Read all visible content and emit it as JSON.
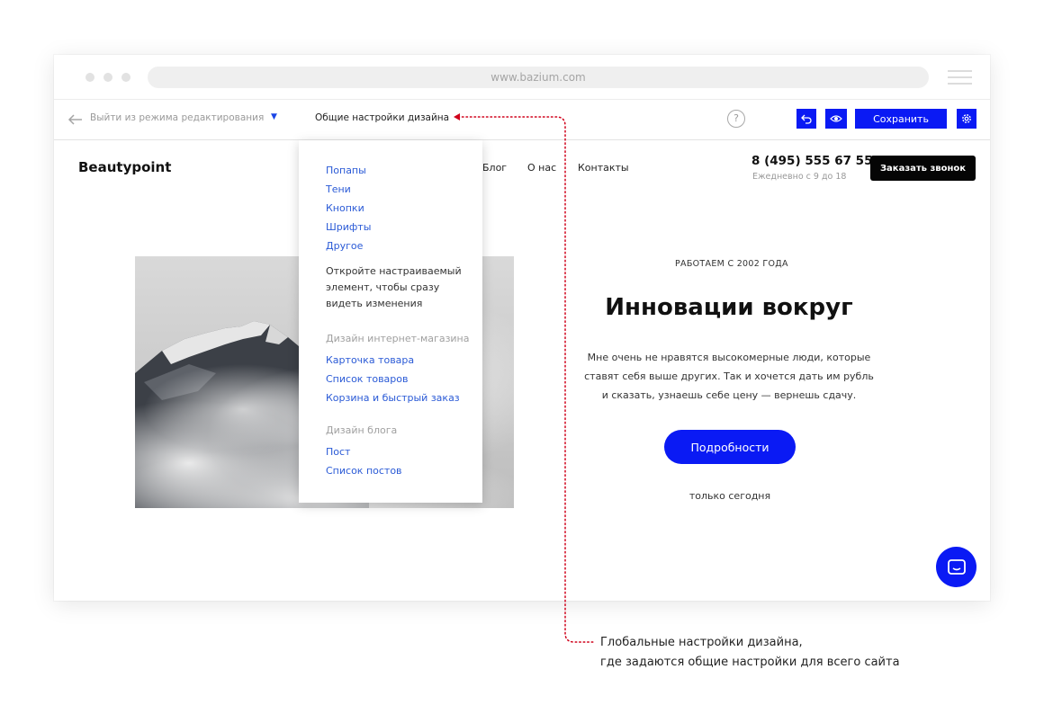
{
  "browser": {
    "url": "www.bazium.com"
  },
  "toolbar": {
    "exit_label": "Выйти из режима редактирования",
    "design_settings_label": "Общие настройки дизайна",
    "help_label": "?",
    "save_label": "Сохранить"
  },
  "site": {
    "logo": "Beautypoint",
    "nav": [
      "Блог",
      "О нас",
      "Контакты"
    ],
    "phone": "8 (495) 555 67 55",
    "hours": "Ежедневно с 9 до 18",
    "callback_label": "Заказать звонок",
    "hero": {
      "since": "РАБОТАЕМ С 2002 ГОДА",
      "title": "Инновации вокруг",
      "description_lines": [
        "Мне очень не нравятся высокомерные люди, которые",
        "ставят себя выше других. Так и хочется дать им рубль",
        "и сказать, узнаешь себе цену — вернешь сдачу."
      ],
      "button_label": "Подробности",
      "note": "только сегодня"
    }
  },
  "dropdown": {
    "general_items": [
      "Попапы",
      "Тени",
      "Кнопки",
      "Шрифты",
      "Другое"
    ],
    "hint_lines": [
      "Откройте настраиваемый",
      "элемент, чтобы сразу",
      "видеть изменения"
    ],
    "shop": {
      "heading": "Дизайн интернет-магазина",
      "items": [
        "Карточка товара",
        "Список товаров",
        "Корзина и быстрый заказ"
      ]
    },
    "blog": {
      "heading": "Дизайн блога",
      "items": [
        "Пост",
        "Список постов"
      ]
    }
  },
  "annotation": {
    "lines": [
      "Глобальные настройки дизайна,",
      "где задаются общие настройки для всего сайта"
    ],
    "color": "#d0021b"
  },
  "colors": {
    "accent": "#0a1af4",
    "link": "#2a5ad6"
  }
}
